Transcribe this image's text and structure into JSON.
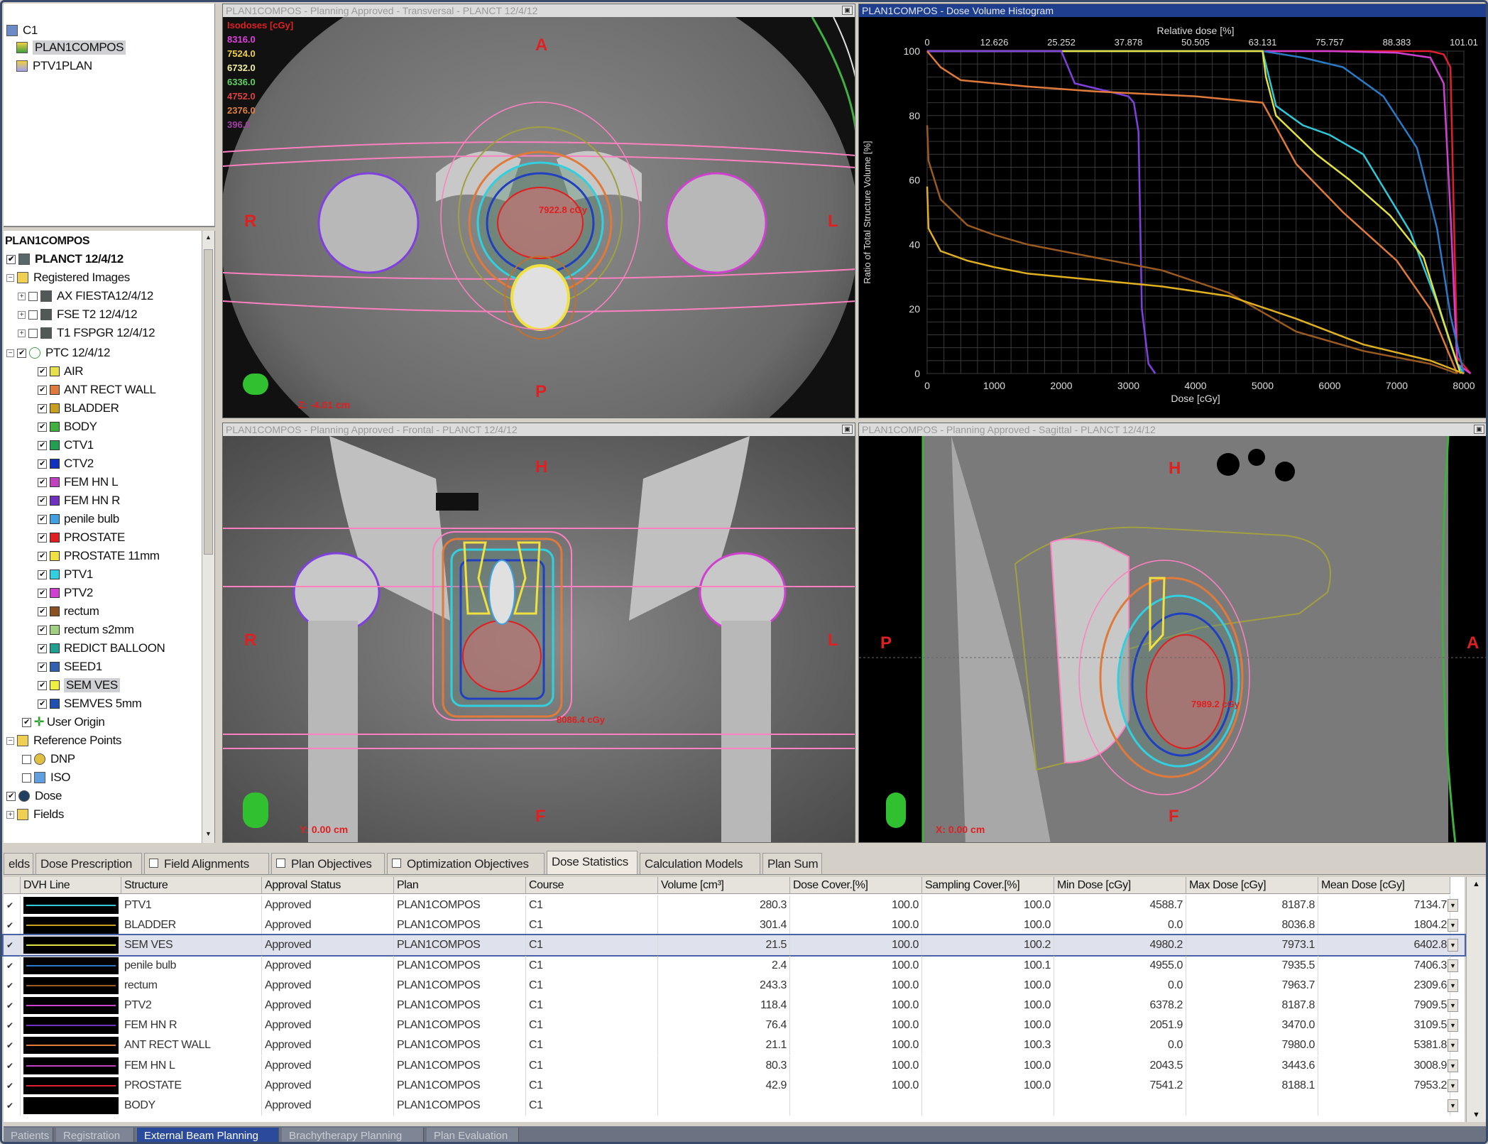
{
  "plans_panel": {
    "root": "C1",
    "items": [
      {
        "label": "PLAN1COMPOS",
        "selected": true
      },
      {
        "label": "PTV1PLAN",
        "selected": false
      }
    ]
  },
  "tree": {
    "title": "PLAN1COMPOS",
    "plan": "PLANCT 12/4/12",
    "registered_images": "Registered Images",
    "images": [
      "AX FIESTA12/4/12",
      "FSE T2 12/4/12",
      "T1 FSPGR 12/4/12"
    ],
    "structure_set": "PTC 12/4/12",
    "structures": [
      {
        "label": "AIR",
        "color": "#e8e04a"
      },
      {
        "label": "ANT RECT WALL",
        "color": "#e07a3a"
      },
      {
        "label": "BLADDER",
        "color": "#c8a020"
      },
      {
        "label": "BODY",
        "color": "#40b040"
      },
      {
        "label": "CTV1",
        "color": "#20a050"
      },
      {
        "label": "CTV2",
        "color": "#1030c0"
      },
      {
        "label": "FEM HN L",
        "color": "#c040c0"
      },
      {
        "label": "FEM HN R",
        "color": "#7030c0"
      },
      {
        "label": "penile bulb",
        "color": "#40a0e0"
      },
      {
        "label": "PROSTATE",
        "color": "#e02020"
      },
      {
        "label": "PROSTATE 11mm",
        "color": "#f0e040"
      },
      {
        "label": "PTV1",
        "color": "#30d0e0"
      },
      {
        "label": "PTV2",
        "color": "#d040d0"
      },
      {
        "label": "rectum",
        "color": "#8a5020"
      },
      {
        "label": "rectum s2mm",
        "color": "#a0d080"
      },
      {
        "label": "REDICT BALLOON",
        "color": "#20a090"
      },
      {
        "label": "SEED1",
        "color": "#3060b0"
      },
      {
        "label": "SEM VES",
        "color": "#f0f040"
      },
      {
        "label": "SEMVES 5mm",
        "color": "#2050b0"
      }
    ],
    "user_origin": "User Origin",
    "reference_points": "Reference Points",
    "ref_items": [
      "DNP",
      "ISO"
    ],
    "dose": "Dose",
    "fields": "Fields"
  },
  "transversal": {
    "title": "PLAN1COMPOS - Planning Approved - Transversal - PLANCT 12/4/12",
    "isodoses_title": "Isodoses [cGy]",
    "isodoses": [
      {
        "value": "8316.0",
        "color": "#e040e0"
      },
      {
        "value": "7524.0",
        "color": "#f0d040"
      },
      {
        "value": "6732.0",
        "color": "#f0f0a0"
      },
      {
        "value": "6336.0",
        "color": "#60d060"
      },
      {
        "value": "4752.0",
        "color": "#e04040"
      },
      {
        "value": "2376.0",
        "color": "#e08040"
      },
      {
        "value": "396.0",
        "color": "#a040a0"
      }
    ],
    "label_a": "A",
    "label_p": "P",
    "label_r": "R",
    "label_l": "L",
    "dose_label": "7922.8 cGy",
    "position": "Z: -4.01 cm"
  },
  "frontal": {
    "title": "PLAN1COMPOS - Planning Approved - Frontal - PLANCT 12/4/12",
    "label_h": "H",
    "label_f": "F",
    "label_r": "R",
    "label_l": "L",
    "dose_label": "8086.4 cGy",
    "position": "Y: 0.00 cm"
  },
  "sagittal": {
    "title": "PLAN1COMPOS - Planning Approved - Sagittal - PLANCT 12/4/12",
    "label_h": "H",
    "label_f": "F",
    "label_p": "P",
    "label_a": "A",
    "dose_label": "7989.2 cGy",
    "position": "X: 0.00 cm"
  },
  "dvh": {
    "title": "PLAN1COMPOS - Dose Volume Histogram",
    "chart_data": {
      "type": "line",
      "xlabel": "Dose [cGy]",
      "ylabel": "Ratio of Total Structure Volume [%]",
      "top_label": "Relative dose [%]",
      "xlim": [
        0,
        8000
      ],
      "ylim": [
        0,
        100
      ],
      "x_ticks": [
        "0",
        "1000",
        "2000",
        "3000",
        "4000",
        "5000",
        "6000",
        "7000",
        "8000"
      ],
      "y_ticks": [
        "0",
        "20",
        "40",
        "60",
        "80",
        "100"
      ],
      "top_ticks": [
        "0",
        "12.626",
        "25.252",
        "37.878",
        "50.505",
        "63.131",
        "75.757",
        "88.383",
        "101.01"
      ],
      "grid": true,
      "series": [
        {
          "color": "#e02030",
          "x": [
            0,
            7500,
            7700,
            7800,
            7850,
            7900,
            8100
          ],
          "y": [
            100,
            100,
            99,
            95,
            50,
            5,
            0
          ]
        },
        {
          "color": "#d040d0",
          "x": [
            0,
            5000,
            6000,
            7000,
            7500,
            7700,
            7800,
            7900,
            8100
          ],
          "y": [
            100,
            100,
            100,
            99.5,
            98,
            90,
            50,
            3,
            0
          ]
        },
        {
          "color": "#30c8d8",
          "x": [
            0,
            5000,
            5200,
            5600,
            6000,
            6500,
            7200,
            7600,
            7900,
            8000
          ],
          "y": [
            100,
            100,
            83,
            77,
            74,
            68,
            44,
            22,
            3,
            0
          ]
        },
        {
          "color": "#2a7ac8",
          "x": [
            0,
            5000,
            5600,
            6200,
            6800,
            7300,
            7600,
            7800,
            8000
          ],
          "y": [
            100,
            100,
            98,
            95,
            86,
            70,
            45,
            18,
            0
          ]
        },
        {
          "color": "#e0e040",
          "x": [
            0,
            5000,
            5050,
            5200,
            5800,
            6300,
            6900,
            7400,
            7700,
            7950
          ],
          "y": [
            100,
            100,
            92,
            80,
            68,
            60,
            49,
            36,
            16,
            0
          ]
        },
        {
          "color": "#8040e0",
          "x": [
            0,
            2000,
            2100,
            2200,
            2800,
            3000,
            3080,
            3150,
            3200,
            3300,
            3400
          ],
          "y": [
            100,
            100,
            95,
            90,
            87,
            86,
            84,
            75,
            20,
            3,
            0
          ]
        },
        {
          "color": "#e07a3a",
          "x": [
            0,
            200,
            500,
            1000,
            1500,
            2500,
            4000,
            5000,
            5500,
            6200,
            7000,
            7500,
            7900
          ],
          "y": [
            100,
            95,
            91,
            90,
            89,
            87.5,
            86,
            84,
            65,
            50,
            35,
            20,
            0
          ]
        },
        {
          "color": "#9a5a20",
          "x": [
            0,
            20,
            200,
            600,
            1000,
            1500,
            2500,
            3500,
            4500,
            5500,
            6500,
            7500,
            7900
          ],
          "y": [
            77,
            66,
            54,
            46,
            43,
            40,
            36,
            32,
            25,
            13,
            7,
            3,
            0
          ]
        },
        {
          "color": "#e0b020",
          "x": [
            0,
            20,
            200,
            600,
            1000,
            1500,
            2500,
            3500,
            4500,
            5500,
            6500,
            7500,
            8000
          ],
          "y": [
            58,
            45,
            38,
            35,
            33,
            31,
            29,
            27,
            24,
            17,
            9,
            4,
            0
          ]
        }
      ]
    }
  },
  "tabs": [
    {
      "label": "elds",
      "check": false
    },
    {
      "label": "Dose Prescription",
      "check": false
    },
    {
      "label": "Field Alignments",
      "check": true
    },
    {
      "label": "Plan Objectives",
      "check": true
    },
    {
      "label": "Optimization Objectives",
      "check": true
    },
    {
      "label": "Dose Statistics",
      "check": false,
      "active": true
    },
    {
      "label": "Calculation Models",
      "check": false
    },
    {
      "label": "Plan Sum",
      "check": false
    }
  ],
  "table": {
    "headers": [
      "DVH Line",
      "Structure",
      "Approval Status",
      "Plan",
      "Course",
      "Volume [cm³]",
      "Dose Cover.[%]",
      "Sampling Cover.[%]",
      "Min Dose [cGy]",
      "Max Dose [cGy]",
      "Mean Dose [cGy]"
    ],
    "rows": [
      {
        "line": "#30c8d8",
        "structure": "PTV1",
        "status": "Approved",
        "plan": "PLAN1COMPOS",
        "course": "C1",
        "volume": "280.3",
        "dose_cover": "100.0",
        "sampling": "100.0",
        "min": "4588.7",
        "max": "8187.8",
        "mean": "7134.7"
      },
      {
        "line": "#c8a020",
        "structure": "BLADDER",
        "status": "Approved",
        "plan": "PLAN1COMPOS",
        "course": "C1",
        "volume": "301.4",
        "dose_cover": "100.0",
        "sampling": "100.0",
        "min": "0.0",
        "max": "8036.8",
        "mean": "1804.2"
      },
      {
        "line": "#e0e040",
        "structure": "SEM VES",
        "status": "Approved",
        "plan": "PLAN1COMPOS",
        "course": "C1",
        "volume": "21.5",
        "dose_cover": "100.0",
        "sampling": "100.2",
        "min": "4980.2",
        "max": "7973.1",
        "mean": "6402.8",
        "selected": true
      },
      {
        "line": "#2a7ac8",
        "structure": "penile bulb",
        "status": "Approved",
        "plan": "PLAN1COMPOS",
        "course": "C1",
        "volume": "2.4",
        "dose_cover": "100.0",
        "sampling": "100.1",
        "min": "4955.0",
        "max": "7935.5",
        "mean": "7406.3"
      },
      {
        "line": "#9a5a20",
        "structure": "rectum",
        "status": "Approved",
        "plan": "PLAN1COMPOS",
        "course": "C1",
        "volume": "243.3",
        "dose_cover": "100.0",
        "sampling": "100.0",
        "min": "0.0",
        "max": "7963.7",
        "mean": "2309.6"
      },
      {
        "line": "#d040d0",
        "structure": "PTV2",
        "status": "Approved",
        "plan": "PLAN1COMPOS",
        "course": "C1",
        "volume": "118.4",
        "dose_cover": "100.0",
        "sampling": "100.0",
        "min": "6378.2",
        "max": "8187.8",
        "mean": "7909.5"
      },
      {
        "line": "#7030c0",
        "structure": "FEM HN R",
        "status": "Approved",
        "plan": "PLAN1COMPOS",
        "course": "C1",
        "volume": "76.4",
        "dose_cover": "100.0",
        "sampling": "100.0",
        "min": "2051.9",
        "max": "3470.0",
        "mean": "3109.5"
      },
      {
        "line": "#e07a3a",
        "structure": "ANT RECT WALL",
        "status": "Approved",
        "plan": "PLAN1COMPOS",
        "course": "C1",
        "volume": "21.1",
        "dose_cover": "100.0",
        "sampling": "100.3",
        "min": "0.0",
        "max": "7980.0",
        "mean": "5381.8"
      },
      {
        "line": "#c040c0",
        "structure": "FEM HN L",
        "status": "Approved",
        "plan": "PLAN1COMPOS",
        "course": "C1",
        "volume": "80.3",
        "dose_cover": "100.0",
        "sampling": "100.0",
        "min": "2043.5",
        "max": "3443.6",
        "mean": "3008.9"
      },
      {
        "line": "#e02030",
        "structure": "PROSTATE",
        "status": "Approved",
        "plan": "PLAN1COMPOS",
        "course": "C1",
        "volume": "42.9",
        "dose_cover": "100.0",
        "sampling": "100.0",
        "min": "7541.2",
        "max": "8188.1",
        "mean": "7953.2"
      },
      {
        "line": "#000000",
        "structure": "BODY",
        "status": "Approved",
        "plan": "PLAN1COMPOS",
        "course": "C1",
        "volume": "",
        "dose_cover": "",
        "sampling": "",
        "min": "",
        "max": "",
        "mean": ""
      }
    ]
  },
  "workspace_tabs": [
    {
      "label": "Patients",
      "active": false
    },
    {
      "label": "Registration",
      "active": false
    },
    {
      "label": "External Beam Planning",
      "active": true
    },
    {
      "label": "Brachytherapy Planning",
      "active": false
    },
    {
      "label": "Plan Evaluation",
      "active": false
    }
  ]
}
